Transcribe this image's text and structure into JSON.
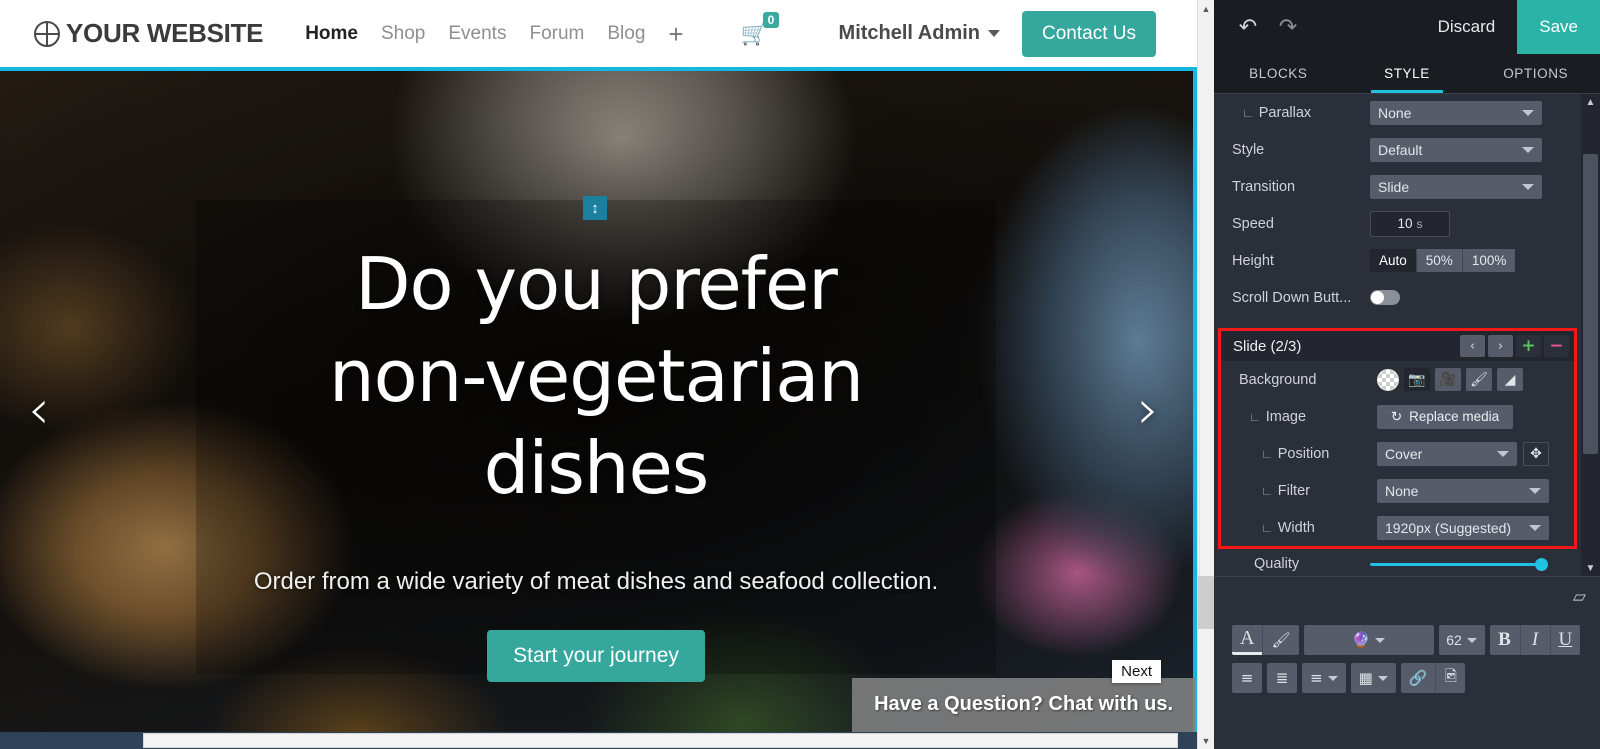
{
  "website": {
    "brand": "YOUR WEBSITE",
    "brand_icon": "globe-icon",
    "nav": [
      {
        "label": "Home",
        "active": true
      },
      {
        "label": "Shop",
        "active": false
      },
      {
        "label": "Events",
        "active": false
      },
      {
        "label": "Forum",
        "active": false
      },
      {
        "label": "Blog",
        "active": false
      }
    ],
    "add_page_icon": "plus-icon",
    "cart": {
      "icon": "shopping-cart-icon",
      "count": "0"
    },
    "user": {
      "name": "Mitchell Admin",
      "caret_icon": "chevron-down-icon"
    },
    "contact_button": "Contact Us"
  },
  "hero": {
    "title": "Do you prefer non-vegetarian dishes",
    "subtitle": "Order from a wide variety of meat dishes and seafood collection.",
    "cta": "Start your journey",
    "prev_arrow": "‹",
    "next_arrow": "›",
    "resize_handle_icon": "vertical-resize-icon",
    "resize_handle_glyph": "↕",
    "tooltip": "Next",
    "chat": "Have a Question? Chat with us."
  },
  "editor": {
    "topbar": {
      "undo_icon": "undo-icon",
      "redo_icon": "redo-icon",
      "undo_glyph": "↶",
      "redo_glyph": "↷",
      "discard": "Discard",
      "save": "Save"
    },
    "tabs": [
      {
        "label": "BLOCKS",
        "active": false
      },
      {
        "label": "STYLE",
        "active": true
      },
      {
        "label": "OPTIONS",
        "active": false
      }
    ],
    "options": [
      {
        "name": "parallax",
        "label": "Parallax",
        "indent": 1,
        "type": "select",
        "value": "None"
      },
      {
        "name": "style",
        "label": "Style",
        "indent": 0,
        "type": "select",
        "value": "Default"
      },
      {
        "name": "transition",
        "label": "Transition",
        "indent": 0,
        "type": "select",
        "value": "Slide"
      },
      {
        "name": "speed",
        "label": "Speed",
        "indent": 0,
        "type": "number",
        "value": "10",
        "unit": "s"
      },
      {
        "name": "height",
        "label": "Height",
        "indent": 0,
        "type": "segmented",
        "segments": [
          {
            "label": "Auto",
            "active": true
          },
          {
            "label": "50%",
            "active": false
          },
          {
            "label": "100%",
            "active": false
          }
        ]
      },
      {
        "name": "scroll-down-button",
        "label": "Scroll Down Butt...",
        "indent": 0,
        "type": "toggle",
        "value": "off"
      }
    ],
    "slide_panel": {
      "title": "Slide (2/3)",
      "highlight_color": "#f51818",
      "nav": {
        "prev_icon": "chevron-left-icon",
        "prev_glyph": "‹",
        "next_icon": "chevron-right-icon",
        "next_glyph": "›",
        "add_icon": "plus-icon",
        "add_glyph": "+",
        "remove_icon": "minus-icon",
        "remove_glyph": "−"
      },
      "background": {
        "label": "Background",
        "icons": [
          {
            "name": "transparent-swatch-icon",
            "glyph": "",
            "active": false
          },
          {
            "name": "camera-image-icon",
            "glyph": "▣",
            "active": true
          },
          {
            "name": "video-film-icon",
            "glyph": "☰",
            "active": false
          },
          {
            "name": "paintbrush-icon",
            "glyph": "╱",
            "active": false
          },
          {
            "name": "gradient-icon",
            "glyph": "◢",
            "active": false
          }
        ]
      },
      "image": {
        "label": "Image",
        "replace_button": "Replace media",
        "replace_icon": "refresh-icon",
        "replace_glyph": "↻"
      },
      "position": {
        "label": "Position",
        "value": "Cover",
        "reposition_icon": "move-target-icon",
        "reposition_glyph": "✥"
      },
      "filter": {
        "label": "Filter",
        "value": "None"
      },
      "width": {
        "label": "Width",
        "value": "1920px (Suggested)"
      }
    },
    "quality": {
      "label": "Quality",
      "accent": "#1fc2e0",
      "value": "100"
    },
    "rich_text": {
      "eraser_icon": "clear-format-icon",
      "eraser_glyph": "▱",
      "row1": [
        {
          "name": "font-color-button",
          "label": "A",
          "kind": "textA"
        },
        {
          "name": "background-color-button",
          "label": "╱",
          "kind": "brush"
        },
        {
          "name": "font-style-button",
          "label": "✦",
          "kind": "wide"
        },
        {
          "name": "font-size-button",
          "label": "62",
          "kind": "fs"
        },
        {
          "name": "bold-button",
          "label": "B",
          "kind": "serif"
        },
        {
          "name": "italic-button",
          "label": "I",
          "kind": "italic"
        },
        {
          "name": "underline-button",
          "label": "U",
          "kind": "uline"
        }
      ],
      "row2": [
        {
          "name": "unordered-list-button",
          "label": "☰",
          "kind": "plain"
        },
        {
          "name": "ordered-list-button",
          "label": "☰",
          "kind": "plain"
        },
        {
          "name": "align-button",
          "label": "☰",
          "kind": "dropdown"
        },
        {
          "name": "table-button",
          "label": "▦",
          "kind": "dropdown"
        },
        {
          "name": "link-button",
          "label": "⚭",
          "kind": "plain"
        },
        {
          "name": "image-button",
          "label": "ὛC",
          "kind": "plain"
        }
      ]
    }
  }
}
